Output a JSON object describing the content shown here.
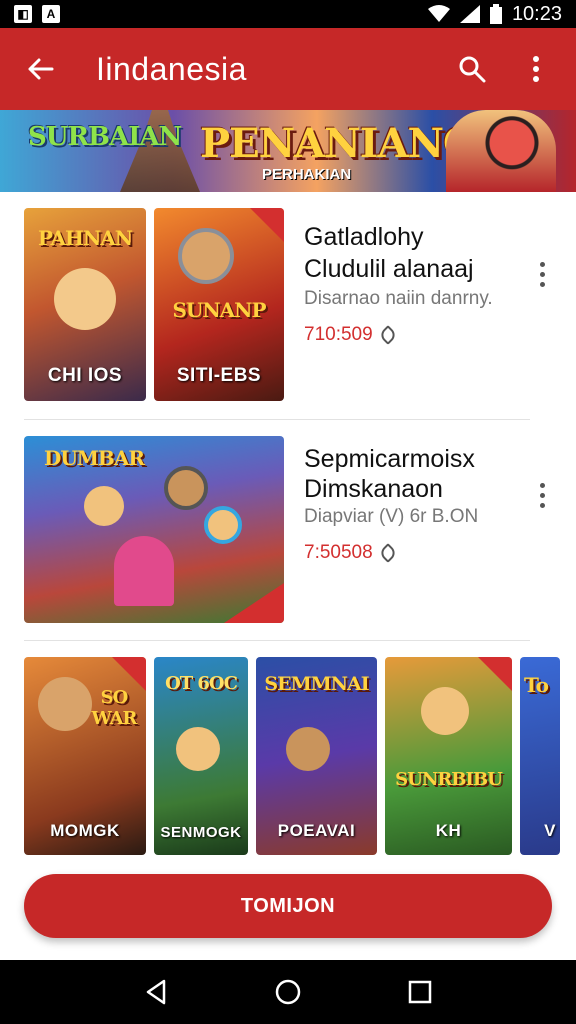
{
  "status_bar": {
    "time": "10:23",
    "left_icons": [
      "gallery-icon",
      "font-icon"
    ],
    "right_icons": [
      "wifi-icon",
      "signal-icon",
      "battery-icon"
    ]
  },
  "app_bar": {
    "title": "Iindanesia",
    "back_icon": "back-arrow-icon",
    "search_icon": "search-icon",
    "menu_icon": "more-vert-icon",
    "color": "#c62828"
  },
  "banner": {
    "left_text": "SURBAIAN",
    "title": "PENANIANON",
    "subtitle": "PERHAKIAN"
  },
  "cards": [
    {
      "thumbs": [
        {
          "title": "PAHNAN",
          "label": "CHI IOS"
        },
        {
          "title": "SUNANP",
          "label": "SITI-EBS"
        }
      ],
      "title_line1": "Gatladlohy",
      "title_line2": "Cludulil alanaaj",
      "subtitle": "Disarnao naiin danrny.",
      "price": "710:509",
      "more_icon": "more-vert-icon",
      "price_icon": "tag-icon"
    },
    {
      "thumbs": [
        {
          "title": "DUMBAR",
          "label": ""
        }
      ],
      "title_line1": "Sepmicarmoisx",
      "title_line2": "Dimskanaon",
      "subtitle": "Diapviar (V) 6r B.ON",
      "price": "7:50508",
      "more_icon": "more-vert-icon",
      "price_icon": "tag-icon"
    }
  ],
  "row": [
    {
      "title": "SO WAR",
      "label": "MOMGK"
    },
    {
      "title": "OT 6OC",
      "label": "SENMOGK"
    },
    {
      "title": "SEMMNAI",
      "label": "POEAVAI"
    },
    {
      "title": "SUNRBIBU",
      "label": "KH"
    },
    {
      "title": "To",
      "label": "V"
    }
  ],
  "cta": {
    "label": "TOMIJON"
  },
  "nav": {
    "back": "nav-back-icon",
    "home": "nav-home-icon",
    "recents": "nav-recents-icon"
  }
}
